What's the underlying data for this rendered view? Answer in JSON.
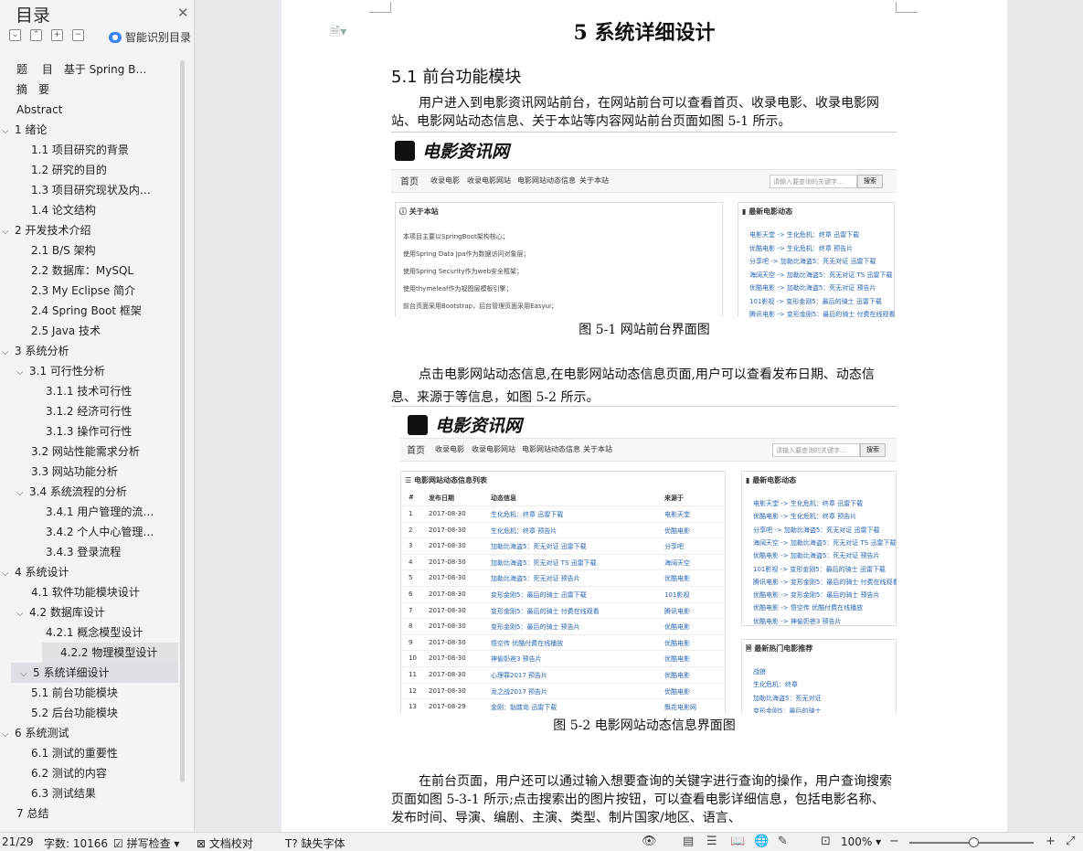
{
  "sidebar": {
    "title": "目录",
    "smart_label": "智能识别目录",
    "toc": [
      {
        "label": "题　 目　基于 Spring B…",
        "level": 0,
        "chev": false
      },
      {
        "label": "摘　要",
        "level": 0,
        "chev": false
      },
      {
        "label": "Abstract",
        "level": 0,
        "chev": false
      },
      {
        "label": "1 绪论",
        "level": 0,
        "chev": true
      },
      {
        "label": "1.1 项目研究的背景",
        "level": 1,
        "chev": false
      },
      {
        "label": "1.2 研究的目的",
        "level": 1,
        "chev": false
      },
      {
        "label": "1.3 项目研究现状及内…",
        "level": 1,
        "chev": false
      },
      {
        "label": "1.4 论文结构",
        "level": 1,
        "chev": false
      },
      {
        "label": "2 开发技术介绍",
        "level": 0,
        "chev": true
      },
      {
        "label": "2.1 B/S 架构",
        "level": 1,
        "chev": false
      },
      {
        "label": "2.2  数据库：MySQL",
        "level": 1,
        "chev": false
      },
      {
        "label": "2.3 My Eclipse 简介",
        "level": 1,
        "chev": false
      },
      {
        "label": "2.4 Spring Boot 框架",
        "level": 1,
        "chev": false
      },
      {
        "label": "2.5 Java 技术",
        "level": 1,
        "chev": false
      },
      {
        "label": "3 系统分析",
        "level": 0,
        "chev": true
      },
      {
        "label": "3.1 可行性分析",
        "level": 1,
        "chev": true
      },
      {
        "label": "3.1.1 技术可行性",
        "level": 2,
        "chev": false
      },
      {
        "label": "3.1.2 经济可行性",
        "level": 2,
        "chev": false
      },
      {
        "label": "3.1.3 操作可行性",
        "level": 2,
        "chev": false
      },
      {
        "label": "3.2 网站性能需求分析",
        "level": 1,
        "chev": false
      },
      {
        "label": "3.3 网站功能分析",
        "level": 1,
        "chev": false
      },
      {
        "label": "3.4 系统流程的分析",
        "level": 1,
        "chev": true
      },
      {
        "label": "3.4.1  用户管理的流…",
        "level": 2,
        "chev": false
      },
      {
        "label": "3.4.2  个人中心管理…",
        "level": 2,
        "chev": false
      },
      {
        "label": "3.4.3  登录流程",
        "level": 2,
        "chev": false
      },
      {
        "label": "4 系统设计",
        "level": 0,
        "chev": true
      },
      {
        "label": "4.1  软件功能模块设计",
        "level": 1,
        "chev": false
      },
      {
        "label": "4.2  数据库设计",
        "level": 1,
        "chev": true
      },
      {
        "label": "4.2.1  概念模型设计",
        "level": 2,
        "chev": false
      },
      {
        "label": "4.2.2  物理模型设计",
        "level": 2,
        "chev": false,
        "hl": true
      },
      {
        "label": "5 系统详细设计",
        "level": 0,
        "chev": true,
        "sel": true
      },
      {
        "label": "5.1 前台功能模块",
        "level": 1,
        "chev": false
      },
      {
        "label": "5.2 后台功能模块",
        "level": 1,
        "chev": false
      },
      {
        "label": "6  系统测试",
        "level": 0,
        "chev": true
      },
      {
        "label": "6.1 测试的重要性",
        "level": 1,
        "chev": false
      },
      {
        "label": "6.2 测试的内容",
        "level": 1,
        "chev": false
      },
      {
        "label": "6.3 测试结果",
        "level": 1,
        "chev": false
      },
      {
        "label": "7 总结",
        "level": 0,
        "chev": false
      }
    ]
  },
  "document": {
    "heading1": "5 系统详细设计",
    "heading2": "5.1 前台功能模块",
    "para1": "用户进入到电影资讯网站前台，在网站前台可以查看首页、收录电影、收录电影网站、电影网站动态信息、关于本站等内容网站前台页面如图 5-1 所示。",
    "caption1": "图 5-1 网站前台界面图",
    "para2": "点击电影网站动态信息,在电影网站动态信息页面,用户可以查看发布日期、动态信息、来源于等信息，如图 5-2 所示。",
    "caption2": "图 5-2 电影网站动态信息界面图",
    "para3": "在前台页面，用户还可以通过输入想要查询的关键字进行查询的操作，用户查询搜索页面如图 5-3-1 所示;点击搜索出的图片按钮，可以查看电影详细信息，包括电影名称、发布时间、导演、编剧、主演、类型、制片国家/地区、语言、"
  },
  "site": {
    "logo": "电影资讯网",
    "nav": [
      "首页",
      "收录电影",
      "收录电影网站",
      "电影网站动态信息",
      "关于本站"
    ],
    "search_placeholder": "请输入要查询的关键字...",
    "search_button": "搜索",
    "about_title": "关于本站",
    "about_lines": [
      "本项目主要以SpringBoot架构核心；",
      "使用Spring Data Jpa作为数据访问对象层；",
      "使用Spring Security作为web安全框架；",
      "使用thymeleaf作为视图层模板引擎；",
      "前台页面采用Bootstrap，后台管理页面采用Easyui；"
    ],
    "news_title": "最新电影动态",
    "news1": [
      "电影天堂 -> 生化危机：终章 迅雷下载",
      "优酷电影 -> 生化危机：终章 预告片",
      "分享吧 -> 加勒比海盗5：死无对证 迅雷下载",
      "海阔天空 -> 加勒比海盗5：死无对证 TS 迅雷下载",
      "优酷电影 -> 加勒比海盗5：死无对证 预告片",
      "101影视 -> 变形金刚5：最后的骑士 迅雷下载",
      "腾讯电影 -> 变形金刚5：最后的骑士 付费在线观看"
    ],
    "news2": [
      "电影天堂 -> 生化危机：终章 迅雷下载",
      "优酷电影 -> 生化危机：终章 预告片",
      "分享吧 -> 加勒比海盗5：死无对证 迅雷下载",
      "海阔天空 -> 加勒比海盗5：死无对证 TS 迅雷下载",
      "优酷电影 -> 加勒比海盗5：死无对证 预告片",
      "101影视 -> 变形金刚5：最后的骑士 迅雷下载",
      "腾讯电影 -> 变形金刚5：最后的骑士 付费在线观看",
      "优酷电影 -> 变形金刚5：最后的骑士 预告片",
      "优酷电影 -> 悟空传 优酷付费在线播放",
      "优酷电影 -> 神偷奶爸3 预告片"
    ],
    "table_title": "电影网站动态信息列表",
    "headers": [
      "#",
      "发布日期",
      "动态信息",
      "来源于"
    ],
    "rows": [
      [
        "1",
        "2017-08-30",
        "生化危机：终章 迅雷下载",
        "电影天堂"
      ],
      [
        "2",
        "2017-08-30",
        "生化危机：终章 预告片",
        "优酷电影"
      ],
      [
        "3",
        "2017-08-30",
        "加勒比海盗5：死无对证 迅雷下载",
        "分享吧"
      ],
      [
        "4",
        "2017-08-30",
        "加勒比海盗5：死无对证 TS 迅雷下载",
        "海阔天空"
      ],
      [
        "5",
        "2017-08-30",
        "加勒比海盗5：死无对证 预告片",
        "优酷电影"
      ],
      [
        "6",
        "2017-08-30",
        "变形金刚5：最后的骑士 迅雷下载",
        "101影视"
      ],
      [
        "7",
        "2017-08-30",
        "变形金刚5：最后的骑士 付费在线观看",
        "腾讯电影"
      ],
      [
        "8",
        "2017-08-30",
        "变形金刚5：最后的骑士 预告片",
        "优酷电影"
      ],
      [
        "9",
        "2017-08-30",
        "悟空传 优酷付费在线播放",
        "优酷电影"
      ],
      [
        "10",
        "2017-08-30",
        "神偷奶爸3 预告片",
        "优酷电影"
      ],
      [
        "11",
        "2017-08-30",
        "心理罪2017 预告片",
        "优酷电影"
      ],
      [
        "12",
        "2017-08-30",
        "龙之战2017 预告片",
        "优酷电影"
      ],
      [
        "13",
        "2017-08-29",
        "金刚：骷髅岛 迅雷下载",
        "飘花电影网"
      ]
    ],
    "hot_title": "最新热门电影推荐",
    "hot": [
      "战狼",
      "生化危机：终章",
      "加勒比海盗5：死无对证",
      "变形金刚5：最后的骑士"
    ]
  },
  "status": {
    "page": "21/29",
    "words": "字数: 10166",
    "spell": "拼写检查",
    "proof": "文档校对",
    "fonts": "缺失字体",
    "zoom": "100%"
  }
}
